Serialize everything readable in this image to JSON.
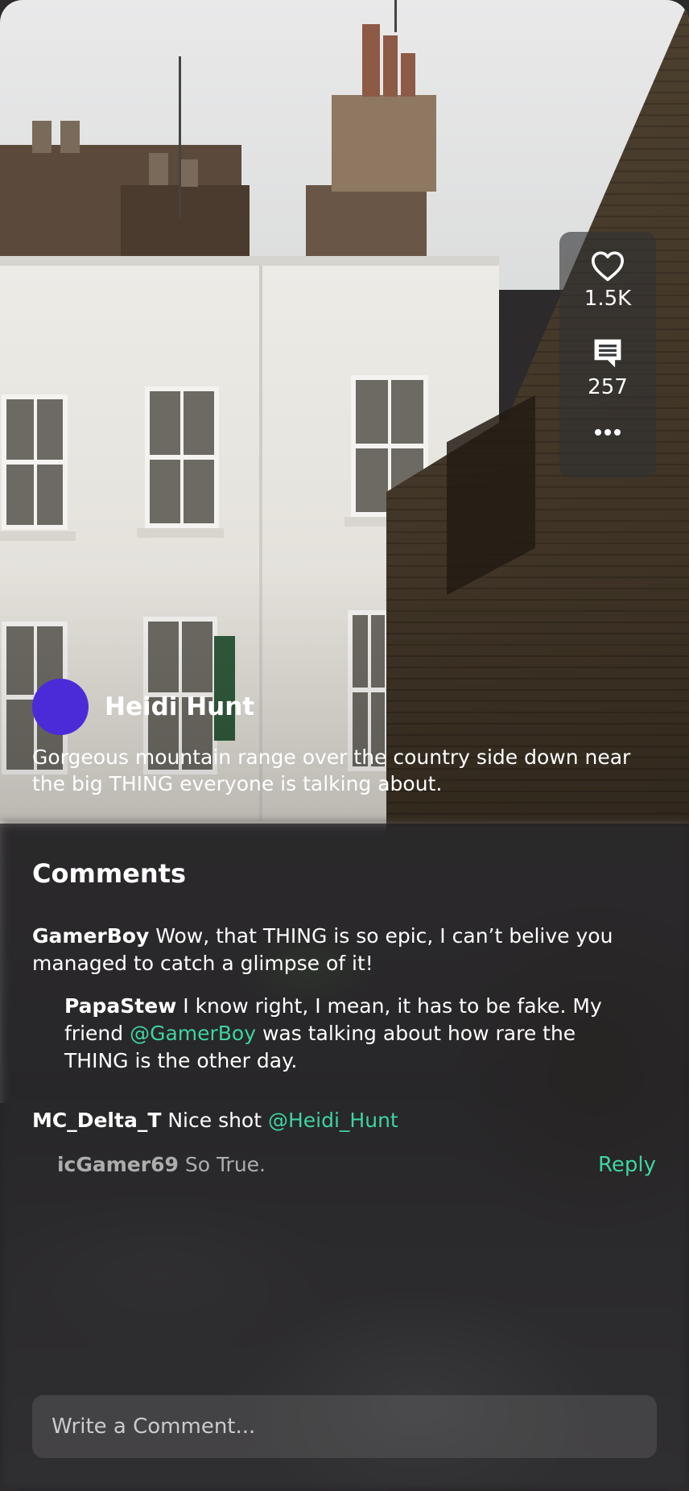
{
  "post": {
    "author": "Heidi Hunt",
    "caption": "Gorgeous mountain range over the country side down near the big THING everyone is talking about.",
    "avatar_color": "#4b2bd8"
  },
  "actions": {
    "likes": "1.5K",
    "comments": "257",
    "like_icon": "heart-icon",
    "comment_icon": "comment-icon",
    "more_icon": "more-dots-icon"
  },
  "comments": {
    "title": "Comments",
    "items": [
      {
        "user": "GamerBoy",
        "text_before": "Wow, that THING is so epic, I can’t belive you managed to catch a glimpse of it!",
        "mention": "",
        "text_after": ""
      },
      {
        "user": "PapaStew",
        "text_before": "I know right, I mean, it has to be fake. My friend",
        "mention": "@GamerBoy",
        "text_after": "was talking about how rare the THING is the other day."
      },
      {
        "user": "MC_Delta_T",
        "text_before": "Nice shot",
        "mention": "@Heidi_Hunt",
        "text_after": ""
      },
      {
        "user": "icGamer69",
        "text_before": "So True.",
        "mention": "",
        "text_after": ""
      }
    ],
    "reply_label": "Reply",
    "input_placeholder": "Write a Comment..."
  },
  "colors": {
    "accent": "#3fd3a0",
    "sheet_bg": "#1e1e22"
  }
}
